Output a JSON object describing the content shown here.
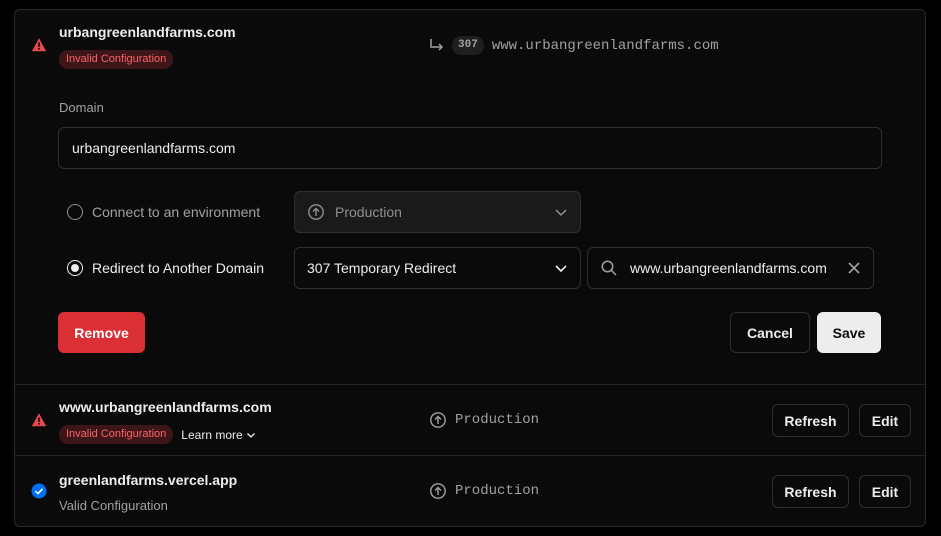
{
  "primary_domain": {
    "name": "urbangreenlandfarms.com",
    "status": "Invalid Configuration",
    "redirect_code": "307",
    "redirect_target": "www.urbangreenlandfarms.com"
  },
  "form": {
    "domain_label": "Domain",
    "domain_value": "urbangreenlandfarms.com",
    "option_connect_label": "Connect to an environment",
    "option_redirect_label": "Redirect to Another Domain",
    "selected_option": "redirect",
    "environment_select_value": "Production",
    "redirect_select_value": "307 Temporary Redirect",
    "redirect_target_value": "www.urbangreenlandfarms.com",
    "remove_label": "Remove",
    "cancel_label": "Cancel",
    "save_label": "Save"
  },
  "domains": [
    {
      "name": "www.urbangreenlandfarms.com",
      "status": "Invalid Configuration",
      "learn_more": "Learn more",
      "environment": "Production",
      "refresh_label": "Refresh",
      "edit_label": "Edit"
    },
    {
      "name": "greenlandfarms.vercel.app",
      "status": "Valid Configuration",
      "environment": "Production",
      "refresh_label": "Refresh",
      "edit_label": "Edit"
    }
  ],
  "colors": {
    "error": "#da2f35",
    "success": "#0070f3",
    "background": "#0a0a0a"
  },
  "icons": {
    "warning": "warning-triangle-icon",
    "redirect": "redirect-arrow-icon",
    "environment": "arrow-up-circle-icon",
    "search": "search-icon",
    "clear": "close-icon",
    "chevron": "chevron-down-icon",
    "valid": "check-circle-icon"
  }
}
